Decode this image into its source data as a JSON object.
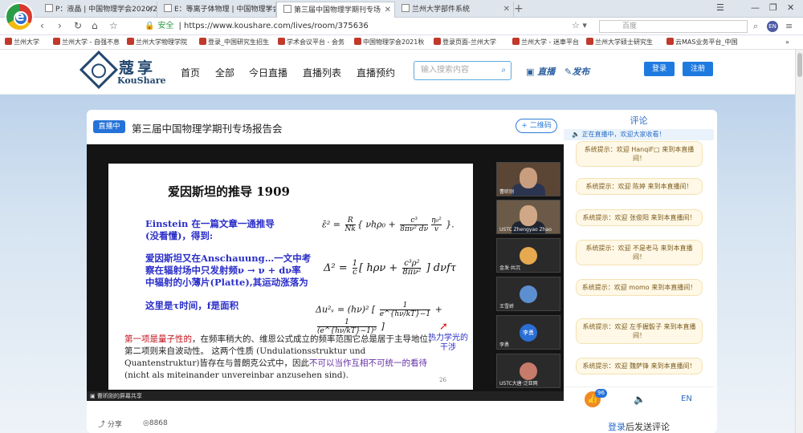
{
  "browser": {
    "tabs": [
      {
        "label": "P：液晶 | 中国物理学会2020/20"
      },
      {
        "label": "E：等离子体物理 | 中国物理学会20"
      },
      {
        "label": "第三届中国物理学期刊专场"
      },
      {
        "label": "兰州大学部件系统"
      }
    ],
    "url_secure": "安全",
    "url": "https://www.koushare.com/lives/room/375636",
    "search_placeholder": "百度",
    "ext_label": "EN"
  },
  "bookmarks": [
    "兰州大学",
    "兰州大学 - 自强不息",
    "兰州大学物理学院",
    "登录_中国研究生招生",
    "学术会议平台 - 会务",
    "中国物理学会2021秋",
    "登录页面-兰州大学",
    "兰州大学 - 迷車平台",
    "兰州大学硕士研究生",
    "云MAS业务平台_中国"
  ],
  "site": {
    "logo_cn": "蔻享",
    "logo_en": "KouShare",
    "nav": [
      "首页",
      "全部",
      "今日直播",
      "直播列表",
      "直播预约"
    ],
    "search_placeholder": "输入搜索内容",
    "live_label": "直播",
    "publish_label": "发布",
    "login_label": "登录",
    "register_label": "注册"
  },
  "room": {
    "badge": "直播中",
    "title": "第三届中国物理学期刊专场报告会",
    "qr_label": "+ 二维码",
    "share_label": "分享",
    "views": "8868",
    "screen_share_label": "曹昕刚的屏幕共享"
  },
  "slide": {
    "title": "爱因斯坦的推导  1909",
    "block1": "Einstein 在一篇文章一通推导\n(没看懂)，得到:",
    "block2": "爱因斯坦又在Anschauung…一文中考\n察在辐射场中只发射频ν → ν + dν率\n中辐射的小薄片(Platte),其运动涨落为",
    "block3": "这里是τ时间，f是面积",
    "para_red": "第一项是量子性的",
    "para_body": "，在频率稍大的、维恩公式成立的频率范围它总是居于主导地位，第二项则来自波动性。 这两个性质 (Undulationsstruktur und Quantenstruktur)皆存在与普朗克公式中，因此",
    "para_purple": "不可以当作互相不可统一的看待",
    "para_tail": "(nicht als miteinander unvereinbar anzusehen sind).",
    "annotation": "热力学光的干涉",
    "page_no": "26"
  },
  "participants": [
    {
      "name": "曹昕刚"
    },
    {
      "name": "USTC Zhengyao Zhao"
    },
    {
      "name": "金发·共沉"
    },
    {
      "name": "王雪娇"
    },
    {
      "name": "李勇"
    },
    {
      "name": "USTC大唐·泛亚网"
    }
  ],
  "participant_avatar_text": "李勇",
  "comments": {
    "title": "评论",
    "notice": "正在直播中，欢迎大家收看！",
    "items": [
      "系统提示：欢迎 HanqiF□ 来到本直播间！",
      "系统提示：欢迎 陈婷 来到本直播间！",
      "系统提示：欢迎 张俊阳 来到本直播间！",
      "系统提示：欢迎 不是老马 来到本直播间！",
      "系统提示：欢迎 momo 来到本直播间！",
      "系统提示：欢迎 左手握骰子 来到本直播间！",
      "系统提示：欢迎 魏萨锋 来到本直播间！"
    ],
    "like_count": "96",
    "lang_label": "EN",
    "login_link": "登录",
    "login_suffix": "后发送评论"
  }
}
